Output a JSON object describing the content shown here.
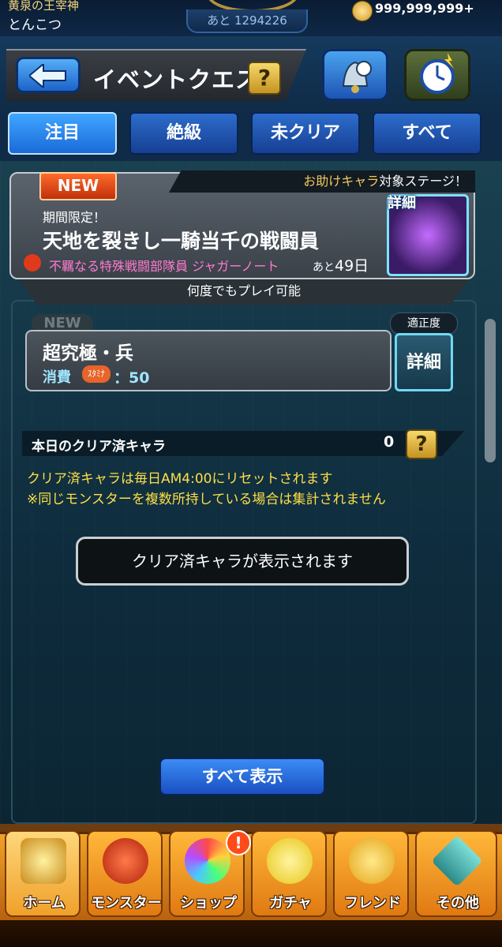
{
  "status": {
    "player_title": "黄泉の王宰神",
    "player_name": "とんこつ",
    "exp_remaining": "あと 1294226",
    "coins": "999,999,999+"
  },
  "header": {
    "title": "イベントクエスト",
    "help_label": "?",
    "icons": [
      "back-arrow-icon",
      "bell-icon",
      "stopwatch-icon"
    ]
  },
  "tabs": [
    {
      "label": "注目",
      "active": true
    },
    {
      "label": "絶級",
      "active": false
    },
    {
      "label": "未クリア",
      "active": false
    },
    {
      "label": "すべて",
      "active": false
    }
  ],
  "quest": {
    "badge": "NEW",
    "support_prefix": "お助けキャラ",
    "support_suffix": "対象ステージ！",
    "limited": "期間限定！",
    "title": "天地を裂きし一騎当千の戦闘員",
    "boss": "不羈なる特殊戦闘部隊員 ジャガーノート",
    "days_prefix": "あと",
    "days_value": "49日",
    "detail_label": "詳細",
    "replay_note": "何度でもプレイ可能"
  },
  "difficulty": {
    "badge": "NEW",
    "name": "超究極・兵",
    "stamina_label": "消費",
    "stamina_icon_text": "ｽﾀﾐﾅ",
    "stamina_value": "：50",
    "aptitude_label": "適正度",
    "detail_label": "詳細"
  },
  "cleared": {
    "label": "本日のクリア済キャラ",
    "count": "0",
    "help_label": "?",
    "note1": "クリア済キャラは毎日AM4:00にリセットされます",
    "note2": "※同じモンスターを複数所持している場合は集計されません",
    "placeholder": "クリア済キャラが表示されます",
    "show_all": "すべて表示"
  },
  "nav": [
    {
      "label": "ホーム",
      "icon": "home-icon",
      "active": true
    },
    {
      "label": "モンスター",
      "icon": "monster-icon",
      "active": false
    },
    {
      "label": "ショップ",
      "icon": "shop-orb-icon",
      "active": false
    },
    {
      "label": "ガチャ",
      "icon": "gacha-egg-icon",
      "active": false
    },
    {
      "label": "フレンド",
      "icon": "friend-icon",
      "active": false
    },
    {
      "label": "その他",
      "icon": "other-icon",
      "active": false
    }
  ],
  "shop_alert": "!"
}
